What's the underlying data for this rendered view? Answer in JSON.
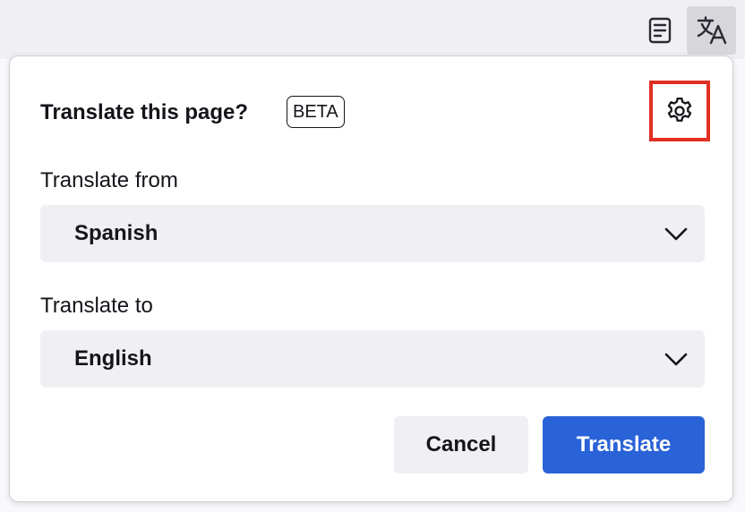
{
  "toolbar": {
    "reader_icon": "reader-view-icon",
    "translate_icon": "translate-icon"
  },
  "panel": {
    "title": "Translate this page?",
    "badge": "BETA",
    "settings_icon": "gear-icon",
    "from": {
      "label": "Translate from",
      "value": "Spanish"
    },
    "to": {
      "label": "Translate to",
      "value": "English"
    },
    "cancel_label": "Cancel",
    "translate_label": "Translate"
  },
  "colors": {
    "primary_button": "#2a62d8",
    "highlight_border": "#e22f24",
    "select_background": "#f0f0f4"
  }
}
